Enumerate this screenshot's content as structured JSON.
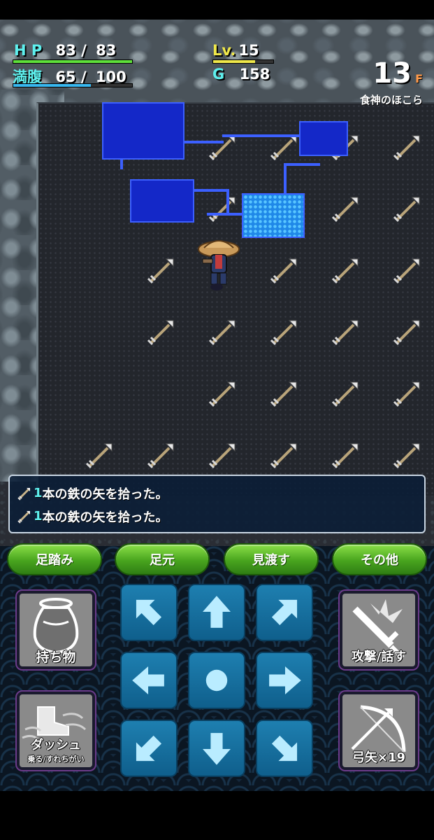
{
  "hud": {
    "hp_label": "H P",
    "hp_current": "83",
    "hp_sep": "/",
    "hp_max": "83",
    "hunger_label": "満腹",
    "hunger_current": "65",
    "hunger_sep": "/",
    "hunger_max": "100",
    "level_label": "Lv.",
    "level_value": "15",
    "gold_label": "G",
    "gold_value": "158",
    "floor_number": "13",
    "floor_suffix": "F",
    "dungeon_name": "食神のほこら",
    "hp_fraction": 1.0,
    "hunger_fraction": 0.65,
    "exp_fraction": 0.7
  },
  "messages": [
    {
      "count": "1",
      "text": "本の鉄の矢を拾った。"
    },
    {
      "count": "1",
      "text": "本の鉄の矢を拾った。"
    }
  ],
  "actions": {
    "stomp": "足踏み",
    "underfoot": "足元",
    "look_around": "見渡す",
    "other": "その他"
  },
  "side_buttons": {
    "inventory": "持ち物",
    "attack_talk": "攻撃/話す",
    "dash": "ダッシュ",
    "dash_sub": "乗る/すれちがい",
    "bow": "弓矢×19"
  },
  "colors": {
    "hp_bar": "#5ee03a",
    "hunger_bar": "#38b8f0",
    "exp_bar": "#f0e84a",
    "accent_cyan": "#5ef0ee",
    "button_green": "#48a41e",
    "dpad_blue": "#1e7fb0"
  },
  "icons": {
    "item_on_floor": "iron-arrow-icon",
    "inventory": "pot-icon",
    "attack": "sword-slash-icon",
    "dash": "dash-boot-icon",
    "bow": "bow-arrow-icon"
  }
}
